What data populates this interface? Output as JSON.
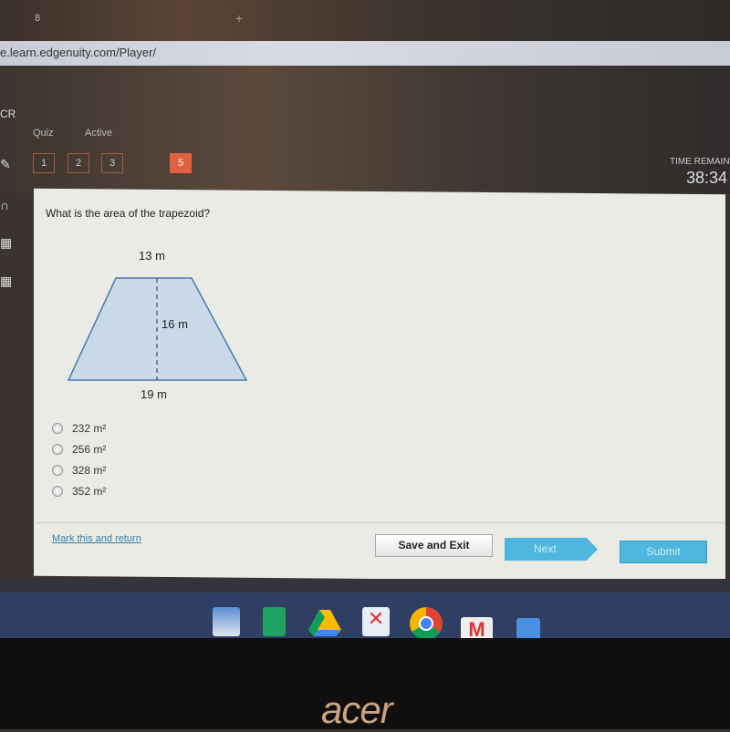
{
  "browser": {
    "tab_title": "8",
    "url": "e.learn.edgenuity.com/Player/"
  },
  "header": {
    "app_label": "CR",
    "quiz_label": "Quiz",
    "status_label": "Active",
    "questions": [
      "1",
      "2",
      "3",
      "5"
    ],
    "current_question": "5",
    "time_label": "TIME REMAIN",
    "time_value": "38:34"
  },
  "question": {
    "text": "What is the area of the trapezoid?",
    "figure": {
      "top_label": "13 m",
      "height_label": "16 m",
      "bottom_label": "19 m"
    },
    "options": [
      "232 m²",
      "256 m²",
      "328 m²",
      "352 m²"
    ]
  },
  "footer": {
    "mark_label": "Mark this and return",
    "save_label": "Save and Exit",
    "next_label": "Next",
    "submit_label": "Submit"
  },
  "taskbar": {
    "apps": [
      "app-icon",
      "sheets-icon",
      "drive-icon",
      "edgenuity-icon",
      "chrome-icon",
      "gmail-icon",
      "docs-icon"
    ]
  },
  "bezel": {
    "brand": "acer"
  },
  "colors": {
    "accent": "#4fb6e0",
    "current_question": "#e0603f",
    "figure_fill": "#c9d9e8"
  }
}
